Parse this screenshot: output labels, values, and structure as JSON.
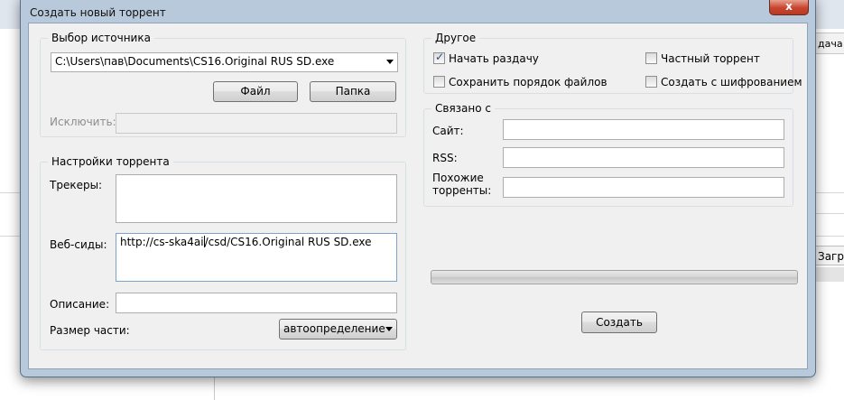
{
  "background": {
    "column_header": "дача",
    "tab_label": "Загру"
  },
  "dialog": {
    "title": "Создать новый торрент",
    "close_label": "x",
    "source": {
      "legend": "Выбор источника",
      "path": "C:\\Users\\пав\\Documents\\CS16.Original RUS SD.exe",
      "file_button": "Файл",
      "folder_button": "Папка",
      "exclude_label": "Исключить:",
      "exclude_value": ""
    },
    "torrent_settings": {
      "legend": "Настройки торрента",
      "trackers_label": "Трекеры:",
      "trackers_value": "",
      "webseeds_label": "Веб-сиды:",
      "webseeds_value_before_caret": "http://cs-ska4ai",
      "webseeds_value_after_caret": "/csd/CS16.Original RUS SD.exe",
      "description_label": "Описание:",
      "description_value": "",
      "piece_size_label": "Размер части:",
      "piece_size_value": "автоопределение"
    },
    "other": {
      "legend": "Другое",
      "start_seeding": {
        "label": "Начать раздачу",
        "checked": true
      },
      "private_torrent": {
        "label": "Частный торрент",
        "checked": false
      },
      "preserve_order": {
        "label": "Сохранить порядок файлов",
        "checked": false
      },
      "create_encrypted": {
        "label": "Создать с шифрованием",
        "checked": false
      }
    },
    "linked": {
      "legend": "Связано с",
      "site_label": "Сайт:",
      "site_value": "",
      "rss_label": "RSS:",
      "rss_value": "",
      "similar_label_line1": "Похожие",
      "similar_label_line2": "торренты:",
      "similar_value": ""
    },
    "progress": 0,
    "create_button": "Создать"
  }
}
